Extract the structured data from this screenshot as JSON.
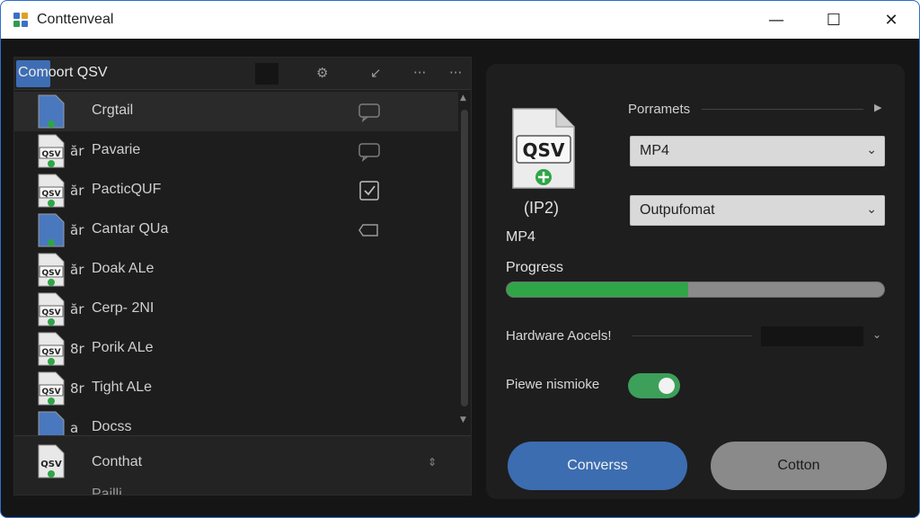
{
  "window": {
    "title": "Conttenveal",
    "controls": {
      "minimize": "—",
      "maximize": "☐",
      "close": "✕"
    }
  },
  "left_panel": {
    "title": "Comoort QSV",
    "tools": [
      "⚙",
      "↙",
      "···",
      "···"
    ],
    "items": [
      {
        "prefix": "",
        "label": "Crgtail",
        "file_text": "",
        "action_icon": "message-icon",
        "selected": true
      },
      {
        "prefix": "ăr",
        "label": "Pavarie",
        "file_text": "QSV",
        "action_icon": "message-icon",
        "selected": false
      },
      {
        "prefix": "ăr",
        "label": "PacticQUF",
        "file_text": "QSV",
        "action_icon": "checkbox-icon",
        "selected": false
      },
      {
        "prefix": "ăr",
        "label": "Cantar QUa",
        "file_text": "",
        "action_icon": "tag-icon",
        "selected": false
      },
      {
        "prefix": "ăr",
        "label": "Doak ALe",
        "file_text": "QSV",
        "action_icon": "",
        "selected": false
      },
      {
        "prefix": "ăr",
        "label": "Cerp- 2NI",
        "file_text": "QSV",
        "action_icon": "",
        "selected": false
      },
      {
        "prefix": "8r",
        "label": "Porik ALe",
        "file_text": "QSV",
        "action_icon": "",
        "selected": false
      },
      {
        "prefix": "8r",
        "label": "Tight ALe",
        "file_text": "QSV",
        "action_icon": "",
        "selected": false
      },
      {
        "prefix": "a",
        "label": "Docss",
        "file_text": "",
        "action_icon": "",
        "selected": false
      }
    ],
    "footer": {
      "label": "Conthat",
      "file_text": "QSV",
      "next_label": "Pailli"
    }
  },
  "right_panel": {
    "file_icon_text": "QSV",
    "file_caption": "(IP2)",
    "format_label": "MP4",
    "parameters_label": "Porramets",
    "format_select": "MP4",
    "output_select": "Outpufomat",
    "progress_label": "Progress",
    "progress": 0.48,
    "hardware_label": "Hardware Aocels!",
    "preview_label": "Piewe nismioke",
    "preview_enabled": true,
    "convert_button": "Converss",
    "cancel_button": "Cotton"
  },
  "colors": {
    "accent": "#3c6db1",
    "progress": "#2fa548",
    "toggle_on": "#3c9f5a"
  }
}
